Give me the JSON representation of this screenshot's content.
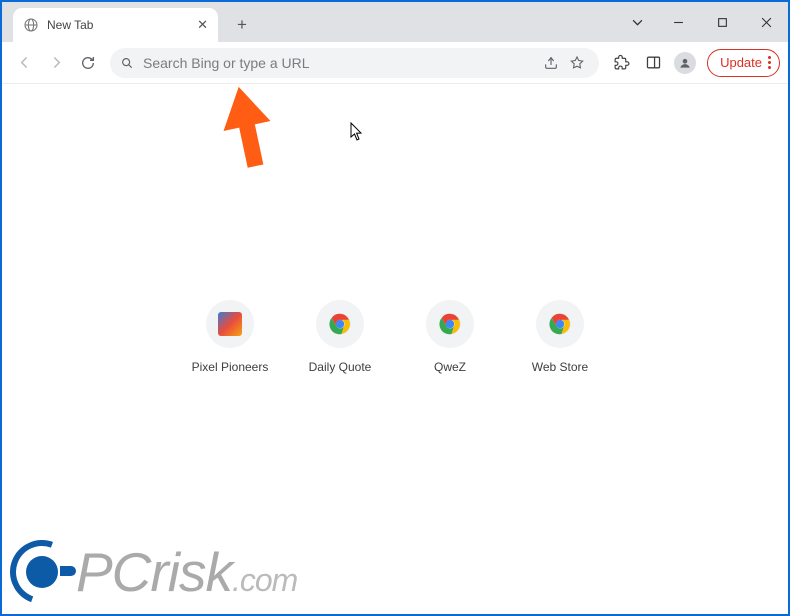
{
  "window": {
    "tab_title": "New Tab"
  },
  "toolbar": {
    "address_placeholder": "Search Bing or type a URL",
    "update_label": "Update"
  },
  "shortcuts": [
    {
      "label": "Pixel Pioneers",
      "icon": "pixel"
    },
    {
      "label": "Daily Quote",
      "icon": "chrome"
    },
    {
      "label": "QweZ",
      "icon": "chrome"
    },
    {
      "label": "Web Store",
      "icon": "chrome"
    }
  ],
  "watermark": {
    "domain": "PCrisk",
    "tld": ".com"
  }
}
